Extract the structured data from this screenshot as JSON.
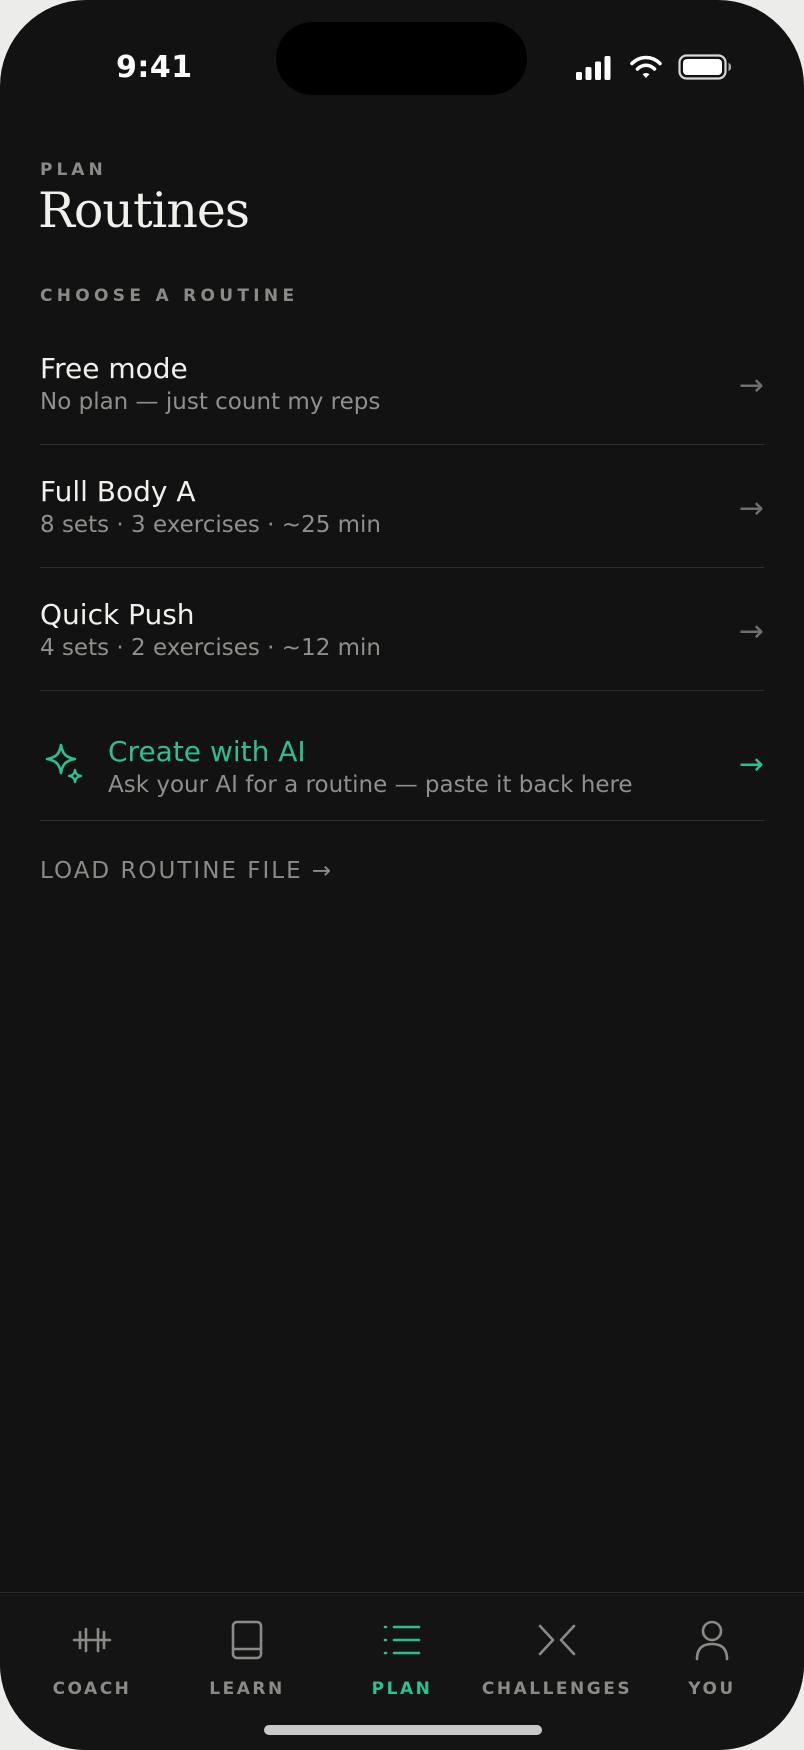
{
  "status_bar": {
    "time": "9:41",
    "icons": [
      "cellular-signal-icon",
      "wifi-icon",
      "battery-icon"
    ]
  },
  "header": {
    "eyebrow": "PLAN",
    "title": "Routines"
  },
  "section": {
    "label": "CHOOSE A ROUTINE"
  },
  "routines": [
    {
      "name": "Free mode",
      "meta": "No plan — just count my reps",
      "arrow": "→"
    },
    {
      "name": "Full Body A",
      "meta": "8 sets · 3 exercises · ~25 min",
      "arrow": "→"
    },
    {
      "name": "Quick Push",
      "meta": "4 sets · 2 exercises · ~12 min",
      "arrow": "→"
    }
  ],
  "ai_routine": {
    "icon": "sparkle-icon",
    "name": "Create with AI",
    "meta": "Ask your AI for a routine — paste it back here",
    "arrow": "→"
  },
  "load_file": {
    "label": "LOAD ROUTINE FILE →"
  },
  "tab_bar": {
    "active": "PLAN",
    "tabs": [
      {
        "label": "COACH",
        "icon": "dumbbell-icon"
      },
      {
        "label": "LEARN",
        "icon": "book-icon"
      },
      {
        "label": "PLAN",
        "icon": "list-icon"
      },
      {
        "label": "CHALLENGES",
        "icon": "versus-icon"
      },
      {
        "label": "YOU",
        "icon": "person-icon"
      }
    ]
  },
  "colors": {
    "background": "#121212",
    "accent": "#2fbf8f",
    "text_primary": "#f1f0ec",
    "text_secondary": "#8f8f8b",
    "divider": "#2d2d2d"
  }
}
